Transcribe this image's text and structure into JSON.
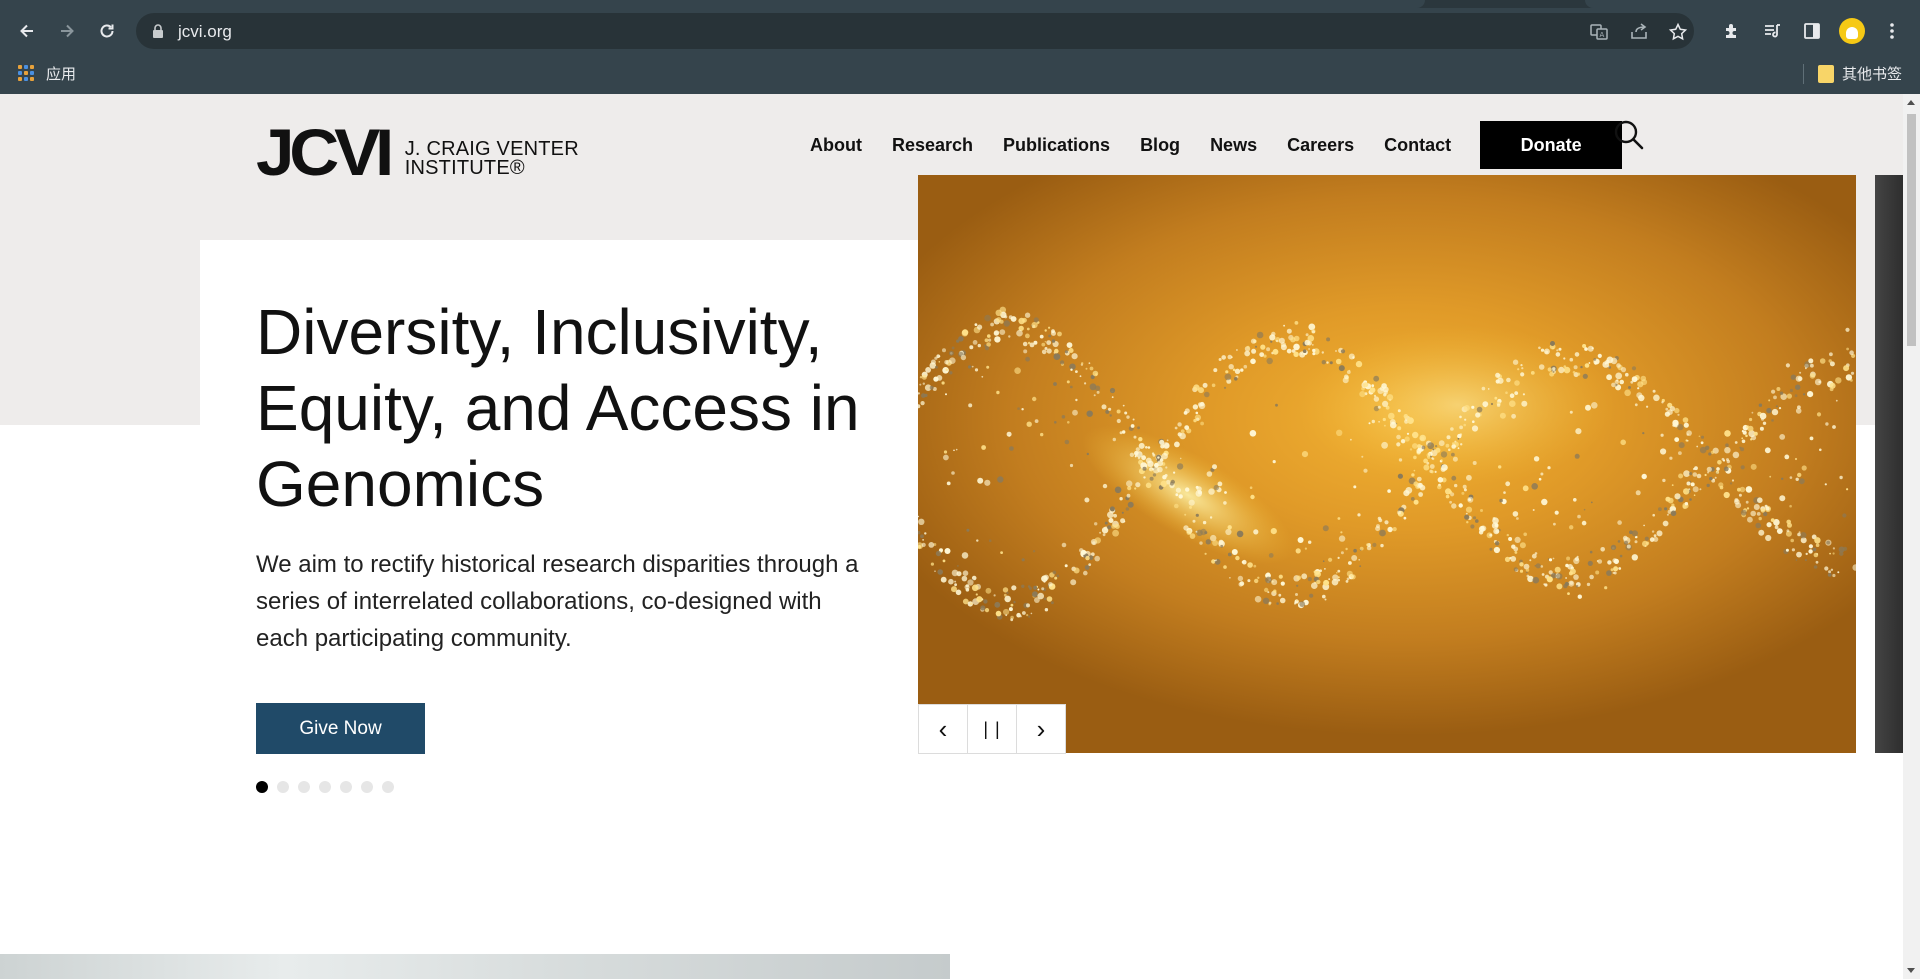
{
  "browser": {
    "url": "jcvi.org",
    "back_icon": "back-arrow-icon",
    "forward_icon": "forward-arrow-icon",
    "reload_icon": "reload-icon",
    "bookmarks": {
      "apps_label": "应用",
      "other_label": "其他书签"
    }
  },
  "site": {
    "logo_mark": "JCVI",
    "logo_line1": "J. CRAIG VENTER",
    "logo_line2": "INSTITUTE®",
    "nav": [
      {
        "label": "About"
      },
      {
        "label": "Research"
      },
      {
        "label": "Publications"
      },
      {
        "label": "Blog"
      },
      {
        "label": "News"
      },
      {
        "label": "Careers"
      },
      {
        "label": "Contact"
      }
    ],
    "donate_label": "Donate"
  },
  "hero": {
    "title": "Diversity, Inclusivity, Equity, and Access in Genomics",
    "description": "We aim to rectify historical research disparities through a series of interrelated collaborations, co-designed with each participating community.",
    "cta_label": "Give Now",
    "slide_count": 7,
    "active_slide": 1,
    "controls": {
      "prev": "‹",
      "pause": "| |",
      "next": "›"
    }
  },
  "colors": {
    "chrome_bg": "#35444c",
    "omnibox_bg": "#283338",
    "page_band": "#eeeceb",
    "cta_bg": "#204a68",
    "donate_bg": "#000000",
    "hero_gold": "#e09a28"
  }
}
